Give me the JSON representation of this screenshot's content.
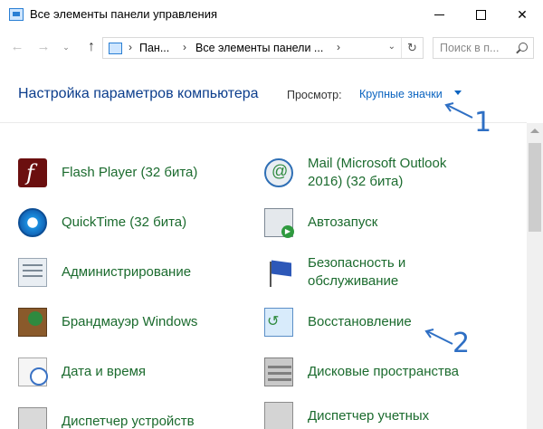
{
  "window": {
    "title": "Все элементы панели управления",
    "minimize_glyph": "—",
    "close_glyph": "✕"
  },
  "nav": {
    "back_glyph": "←",
    "forward_glyph": "→",
    "recent_glyph": "⌄",
    "up_glyph": "↑",
    "breadcrumbs": [
      "Пан...",
      "Все элементы панели ..."
    ],
    "breadcrumb_sep": "›",
    "search_placeholder": "Поиск в п...",
    "refresh_glyph": "↻",
    "dropdown_glyph": "⌄"
  },
  "header": {
    "title": "Настройка параметров компьютера",
    "view_label": "Просмотр:",
    "view_value": "Крупные значки"
  },
  "items": [
    {
      "label": "Flash Player (32 бита)",
      "icon": "flash-player-icon"
    },
    {
      "label": "QuickTime (32 бита)",
      "icon": "quicktime-icon"
    },
    {
      "label": "Администрирование",
      "icon": "administration-icon"
    },
    {
      "label": "Брандмауэр Windows",
      "icon": "firewall-icon"
    },
    {
      "label": "Дата и время",
      "icon": "date-time-icon"
    },
    {
      "label": "Диспетчер устройств",
      "icon": "device-manager-icon"
    },
    {
      "label": "Mail (Microsoft Outlook",
      "label_line2": "2016) (32 бита)",
      "icon": "mail-icon"
    },
    {
      "label": "Автозапуск",
      "icon": "autoplay-icon"
    },
    {
      "label": "Безопасность и",
      "label_line2": "обслуживание",
      "icon": "security-flag-icon"
    },
    {
      "label": "Восстановление",
      "icon": "recovery-icon"
    },
    {
      "label": "Дисковые пространства",
      "icon": "storage-spaces-icon"
    },
    {
      "label": "Диспетчер учетных",
      "icon": "credential-manager-icon"
    }
  ],
  "annotations": {
    "marker_1": "1",
    "marker_2": "2",
    "color": "#2e6fc4"
  },
  "colors": {
    "link_green": "#1b6b2e",
    "header_blue": "#0b3d8c",
    "view_blue": "#0b64c0"
  }
}
